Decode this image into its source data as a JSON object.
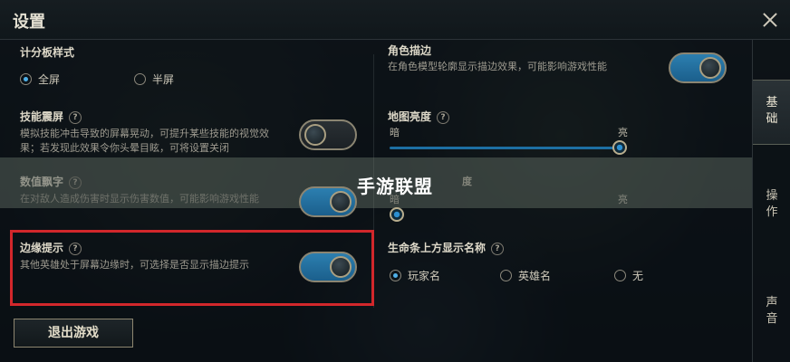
{
  "header": {
    "title": "设置"
  },
  "tabs": [
    {
      "label_top": "基",
      "label_bottom": "础"
    },
    {
      "label_top": "操",
      "label_bottom": "作"
    },
    {
      "label_top": "声",
      "label_bottom": "音"
    }
  ],
  "banner": {
    "text": "手游联盟"
  },
  "settings": {
    "skill_panel_style": {
      "title": "计分板样式",
      "options": [
        "全屏",
        "半屏"
      ],
      "selected": "全屏"
    },
    "char_outline": {
      "title": "角色描边",
      "desc": "在角色模型轮廓显示描边效果，可能影响游戏性能",
      "on": true
    },
    "skill_shake": {
      "title": "技能震屏",
      "desc1": "模拟技能冲击导致的屏幕晃动，可提升某些技能的视觉效",
      "desc2": "果；若发现此效果令你头晕目眩，可将设置关闭",
      "on": false
    },
    "map_brightness": {
      "title": "地图亮度",
      "min_label": "暗",
      "max_label": "亮",
      "value": 1.0
    },
    "damage_numbers": {
      "title": "数值飘字",
      "desc": "在对敌人造成伤害时显示伤害数值，可能影响游戏性能",
      "on": true
    },
    "brightness2": {
      "title_fragment": "度",
      "min_label": "暗",
      "max_label": "亮",
      "value": 0.0
    },
    "edge_hint": {
      "title": "边缘提示",
      "desc": "其他英雄处于屏幕边缘时，可选择是否显示描边提示",
      "on": true
    },
    "health_bar_name": {
      "title": "生命条上方显示名称",
      "options": [
        "玩家名",
        "英雄名",
        "无"
      ],
      "selected": "玩家名"
    }
  },
  "footer": {
    "exit_label": "退出游戏"
  },
  "colors": {
    "accent": "#2c7fb0",
    "highlight": "#d2272b"
  }
}
